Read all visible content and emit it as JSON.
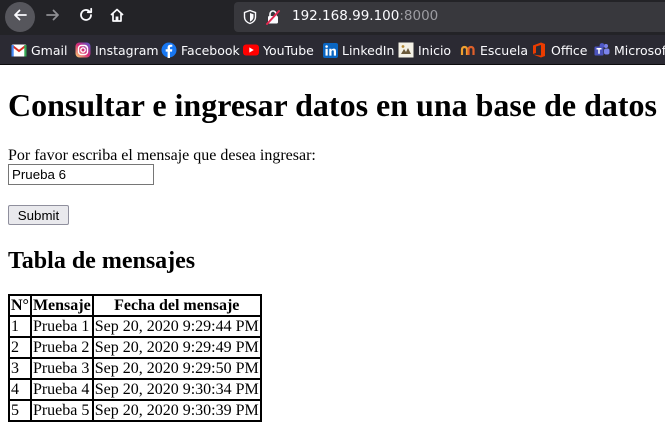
{
  "browser": {
    "url_host": "192.168.99.100",
    "url_port": ":8000",
    "icons": [
      "back-arrow-icon",
      "forward-arrow-icon",
      "reload-icon",
      "home-icon",
      "shield-icon",
      "broken-lock-icon"
    ],
    "bookmarks": [
      {
        "label": "Gmail",
        "icon": "gmail-icon"
      },
      {
        "label": "Instagram",
        "icon": "instagram-icon"
      },
      {
        "label": "Facebook",
        "icon": "facebook-icon"
      },
      {
        "label": "YouTube",
        "icon": "youtube-icon"
      },
      {
        "label": "LinkedIn",
        "icon": "linkedin-icon"
      },
      {
        "label": "Inicio",
        "icon": "inicio-icon"
      },
      {
        "label": "Escuela",
        "icon": "escuela-icon"
      },
      {
        "label": "Office",
        "icon": "office-icon"
      },
      {
        "label": "Microsoft",
        "icon": "teams-icon"
      }
    ]
  },
  "page": {
    "title": "Consultar e ingresar datos en una base de datos",
    "prompt": "Por favor escriba el mensaje que desea ingresar:",
    "input_value": "Prueba 6",
    "submit_label": "Submit",
    "table_title": "Tabla de mensajes",
    "table": {
      "headers": [
        "N°",
        "Mensaje",
        "Fecha del mensaje"
      ],
      "rows": [
        [
          "1",
          "Prueba 1",
          "Sep 20, 2020 9:29:44 PM"
        ],
        [
          "2",
          "Prueba 2",
          "Sep 20, 2020 9:29:49 PM"
        ],
        [
          "3",
          "Prueba 3",
          "Sep 20, 2020 9:29:50 PM"
        ],
        [
          "4",
          "Prueba 4",
          "Sep 20, 2020 9:30:34 PM"
        ],
        [
          "5",
          "Prueba 5",
          "Sep 20, 2020 9:30:39 PM"
        ]
      ]
    }
  },
  "colors": {
    "toolbar_bg": "#232327",
    "urlbar_bg": "#38383d",
    "bookmarks_bg": "#2b2a33",
    "chrome_text": "#fbfbfe",
    "port_text": "#9c9ca2"
  }
}
